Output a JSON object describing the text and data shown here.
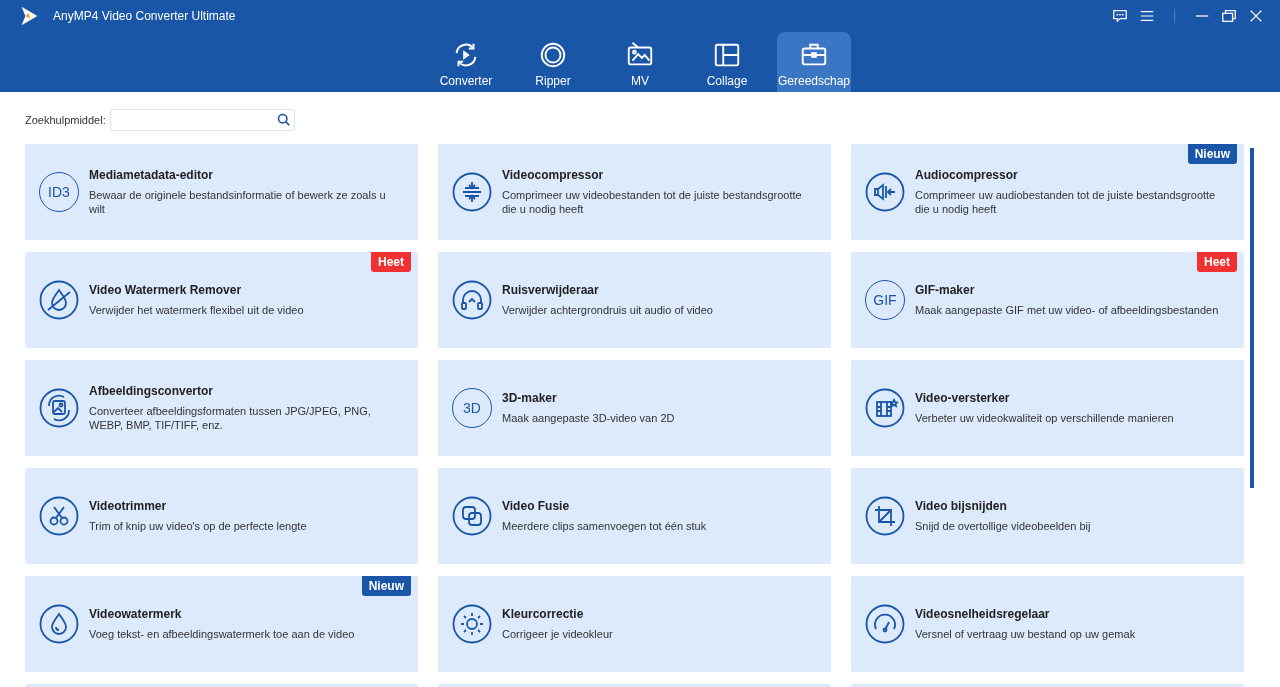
{
  "window": {
    "title": "AnyMP4 Video Converter Ultimate"
  },
  "tabs": [
    {
      "label": "Converter",
      "selected": false
    },
    {
      "label": "Ripper",
      "selected": false
    },
    {
      "label": "MV",
      "selected": false
    },
    {
      "label": "Collage",
      "selected": false
    },
    {
      "label": "Gereedschap",
      "selected": true
    }
  ],
  "search": {
    "label": "Zoekhulpmiddel:"
  },
  "tools": [
    {
      "title": "Mediametadata-editor",
      "description": "Bewaar de originele bestandsinformatie of bewerk ze zoals u wilt",
      "icon_text": "ID3"
    },
    {
      "title": "Videocompressor",
      "description": "Comprimeer uw videobestanden tot de juiste bestandsgrootte die u nodig heeft"
    },
    {
      "title": "Audiocompressor",
      "description": "Comprimeer uw audiobestanden tot de juiste bestandsgrootte die u nodig heeft",
      "badge": {
        "kind": "new",
        "label": "Nieuw"
      }
    },
    {
      "title": "Video Watermerk Remover",
      "description": "Verwijder het watermerk flexibel uit de video",
      "badge": {
        "kind": "hot",
        "label": "Heet"
      }
    },
    {
      "title": "Ruisverwijderaar",
      "description": "Verwijder achtergrondruis uit audio of video"
    },
    {
      "title": "GIF-maker",
      "description": "Maak aangepaste GIF met uw video- of afbeeldingsbestanden",
      "icon_text": "GIF",
      "badge": {
        "kind": "hot",
        "label": "Heet"
      }
    },
    {
      "title": "Afbeeldingsconvertor",
      "description": "Converteer afbeeldingsformaten tussen JPG/JPEG, PNG, WEBP, BMP, TIF/TIFF, enz."
    },
    {
      "title": "3D-maker",
      "description": "Maak aangepaste 3D-video van 2D",
      "icon_text": "3D"
    },
    {
      "title": "Video-versterker",
      "description": "Verbeter uw videokwaliteit op verschillende manieren"
    },
    {
      "title": "Videotrimmer",
      "description": "Trim of knip uw video's op de perfecte lengte"
    },
    {
      "title": "Video Fusie",
      "description": "Meerdere clips samenvoegen tot één stuk"
    },
    {
      "title": "Video bijsnijden",
      "description": "Snijd de overtollige videobeelden bij"
    },
    {
      "title": "Videowatermerk",
      "description": "Voeg tekst- en afbeeldingswatermerk toe aan de video",
      "badge": {
        "kind": "new",
        "label": "Nieuw"
      }
    },
    {
      "title": "Kleurcorrectie",
      "description": "Corrigeer je videokleur"
    },
    {
      "title": "Videosnelheidsregelaar",
      "description": "Versnel of vertraag uw bestand op uw gemak"
    }
  ]
}
